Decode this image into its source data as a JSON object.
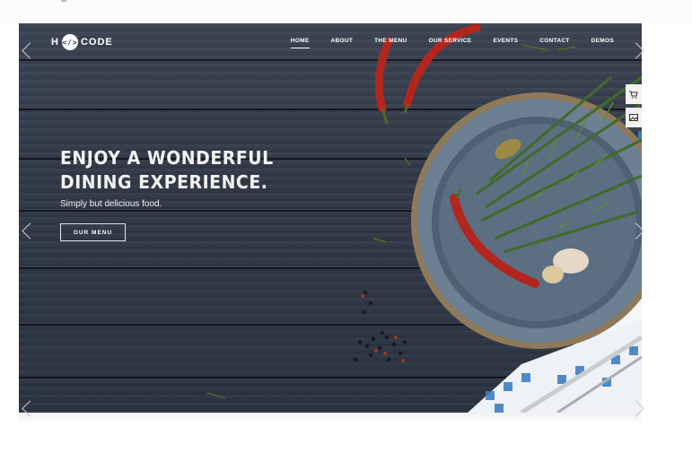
{
  "nav": {
    "logo_text_left": "H",
    "logo_badge": "</>",
    "logo_text_right": "CODE",
    "items": [
      {
        "label": "HOME",
        "active": true
      },
      {
        "label": "ABOUT",
        "active": false
      },
      {
        "label": "THE MENU",
        "active": false
      },
      {
        "label": "OUR SERVICE",
        "active": false
      },
      {
        "label": "EVENTS",
        "active": false
      },
      {
        "label": "CONTACT",
        "active": false
      },
      {
        "label": "DEMOS",
        "active": false
      }
    ]
  },
  "hero": {
    "headline_line1": "ENJOY A WONDERFUL",
    "headline_line2": "DINING EXPERIENCE.",
    "subtitle": "Simply but delicious food.",
    "button_label": "OUR MENU"
  },
  "side_icons": [
    "cart-icon",
    "image-icon"
  ],
  "colors": {
    "wood_dark": "#2f3644",
    "text": "#ffffff",
    "chili": "#b3261e",
    "rosemary": "#3f6b2a",
    "bowl": "#6b7e92",
    "napkin_check": "#3f7fc1"
  }
}
